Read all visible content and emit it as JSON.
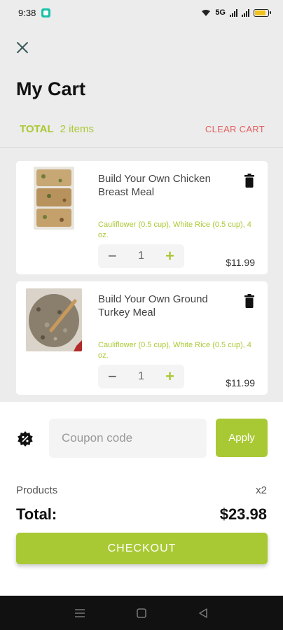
{
  "status_bar": {
    "time": "9:38",
    "network": "5G",
    "battery_color": "#f2c21c",
    "app_icon_color": "#18c2a8"
  },
  "header": {
    "close_icon": "close-icon",
    "title": "My Cart"
  },
  "summary": {
    "total_label": "TOTAL",
    "items_count": "2 items",
    "clear_label": "CLEAR CART"
  },
  "cart_items": [
    {
      "name": "Build Your Own Chicken Breast Meal",
      "options": "Cauliflower (0.5 cup), White Rice (0.5 cup), 4 oz.",
      "quantity": "1",
      "minus": "−",
      "plus": "+",
      "price": "$11.99"
    },
    {
      "name": "Build Your Own Ground Turkey Meal",
      "options": "Cauliflower (0.5 cup), White Rice (0.5 cup), 4 oz.",
      "quantity": "1",
      "minus": "−",
      "plus": "+",
      "price": "$11.99"
    }
  ],
  "coupon": {
    "placeholder": "Coupon code",
    "apply_label": "Apply",
    "icon": "discount-badge-icon"
  },
  "totals": {
    "products_label": "Products",
    "products_count": "x2",
    "total_label": "Total:",
    "total_value": "$23.98"
  },
  "checkout": {
    "label": "CHECKOUT"
  },
  "colors": {
    "accent": "#a9c934",
    "danger": "#e26060",
    "background": "#ececec"
  }
}
